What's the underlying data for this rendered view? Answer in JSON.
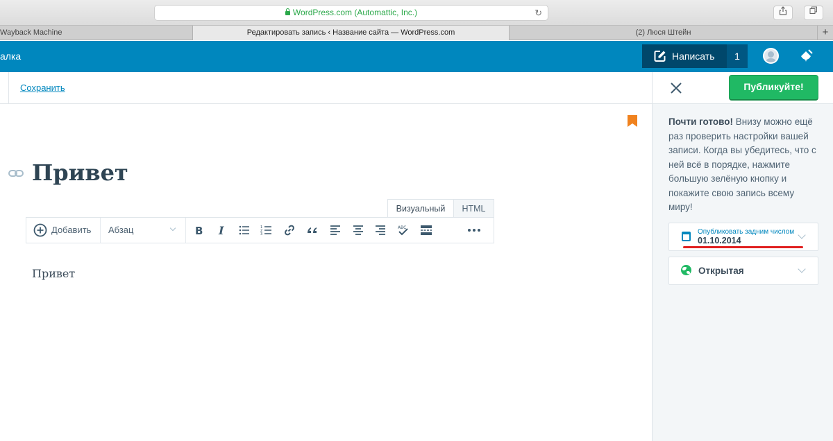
{
  "browser": {
    "address": "WordPress.com (Automattic, Inc.)",
    "tabs": [
      {
        "label": "Wayback Machine",
        "active": false
      },
      {
        "label": "Редактировать запись ‹ Название сайта — WordPress.com",
        "active": true
      },
      {
        "label": "(2) Люся Штейн",
        "active": false
      }
    ],
    "new_tab": "+"
  },
  "masterbar": {
    "title_fragment": "алка",
    "write_label": "Написать",
    "write_count": "1"
  },
  "editor": {
    "save_label": "Сохранить",
    "title": "Привет",
    "mode_tabs": [
      "Визуальный",
      "HTML"
    ],
    "toolbar": {
      "add_label": "Добавить",
      "format_label": "Абзац",
      "buttons": [
        "bold",
        "italic",
        "bullet-list",
        "numbered-list",
        "link",
        "blockquote",
        "align-left",
        "align-center",
        "align-right",
        "spellcheck",
        "read-more",
        "more"
      ]
    },
    "body": "Привет"
  },
  "sidebar": {
    "publish_label": "Публикуйте!",
    "notice_bold": "Почти готово!",
    "notice_text": " Внизу можно ещё раз проверить настройки вашей записи. Когда вы убедитесь, что с ней всё в порядке, нажмите большую зелёную кнопку и покажите свою запись всему миру!",
    "date_label": "Опубликовать задним числом",
    "date_value": "01.10.2014",
    "visibility": "Открытая"
  },
  "colors": {
    "masterbar": "#0087be",
    "masterbar_dark": "#00476b",
    "publish": "#20b964",
    "link": "#0087be",
    "bookmark": "#f0821e",
    "highlight_underline": "#e02020"
  }
}
